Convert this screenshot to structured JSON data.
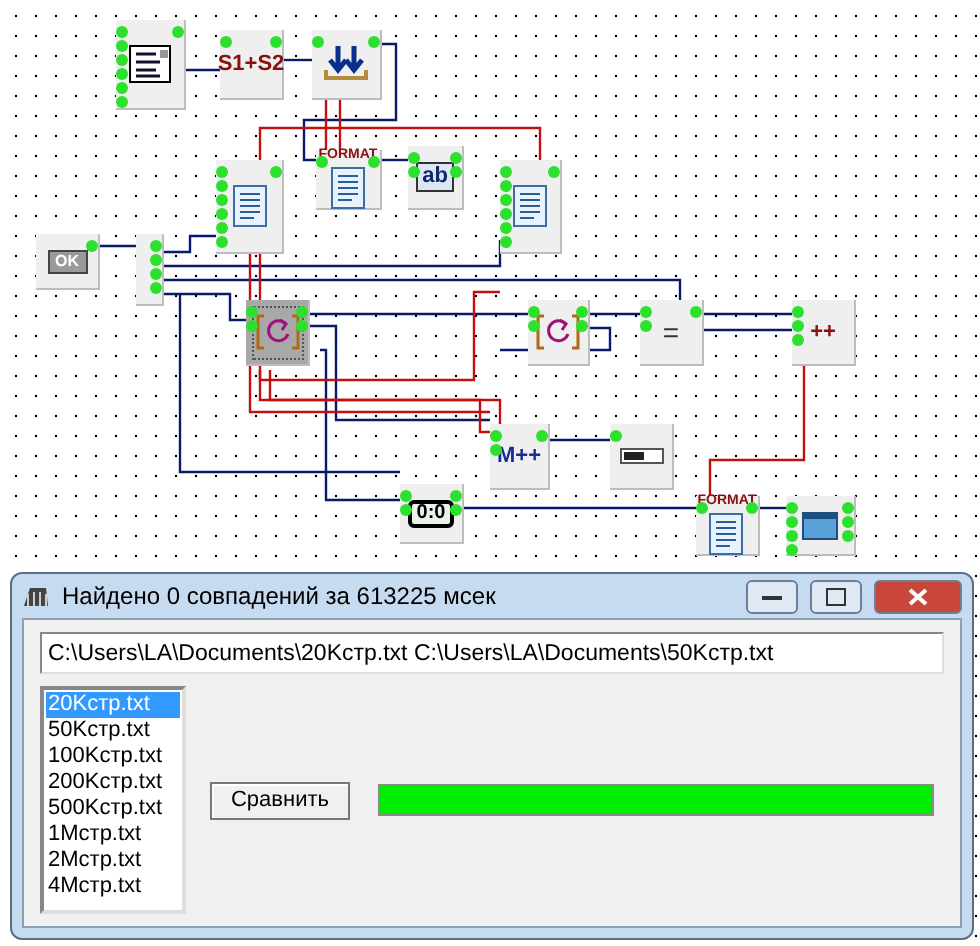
{
  "diagram": {
    "blocks": [
      {
        "kind": "list-icon"
      },
      {
        "kind": "label",
        "label": "S1+S2"
      },
      {
        "kind": "merge-icon"
      },
      {
        "kind": "document-icon"
      },
      {
        "kind": "format",
        "label": "FORMAT"
      },
      {
        "kind": "label",
        "label": "ab"
      },
      {
        "kind": "document-icon"
      },
      {
        "kind": "label",
        "label": "OK"
      },
      {
        "kind": "hub"
      },
      {
        "kind": "loop-icon",
        "selected": true
      },
      {
        "kind": "loop-icon",
        "selected": false
      },
      {
        "kind": "label",
        "label": "="
      },
      {
        "kind": "label",
        "label": "++"
      },
      {
        "kind": "label",
        "label": "M++"
      },
      {
        "kind": "progress-icon"
      },
      {
        "kind": "label",
        "label": "0:0"
      },
      {
        "kind": "format",
        "label": "FORMAT"
      },
      {
        "kind": "window-icon"
      }
    ]
  },
  "window": {
    "title": "Найдено 0 совпадений за 613225 мсек",
    "path_field": {
      "value": "C:\\Users\\LA\\Documents\\20Kстр.txt C:\\Users\\LA\\Documents\\50Kстр.txt"
    },
    "files": [
      {
        "name": "20Kстр.txt",
        "selected": true
      },
      {
        "name": "50Kстр.txt",
        "selected": false
      },
      {
        "name": "100Kстр.txt",
        "selected": false
      },
      {
        "name": "200Kстр.txt",
        "selected": false
      },
      {
        "name": "500Kстр.txt",
        "selected": false
      },
      {
        "name": "1Mстр.txt",
        "selected": false
      },
      {
        "name": "2Mстр.txt",
        "selected": false
      },
      {
        "name": "4Mстр.txt",
        "selected": false
      }
    ],
    "compare_button": "Сравнить",
    "progress": {
      "level": 1
    }
  }
}
